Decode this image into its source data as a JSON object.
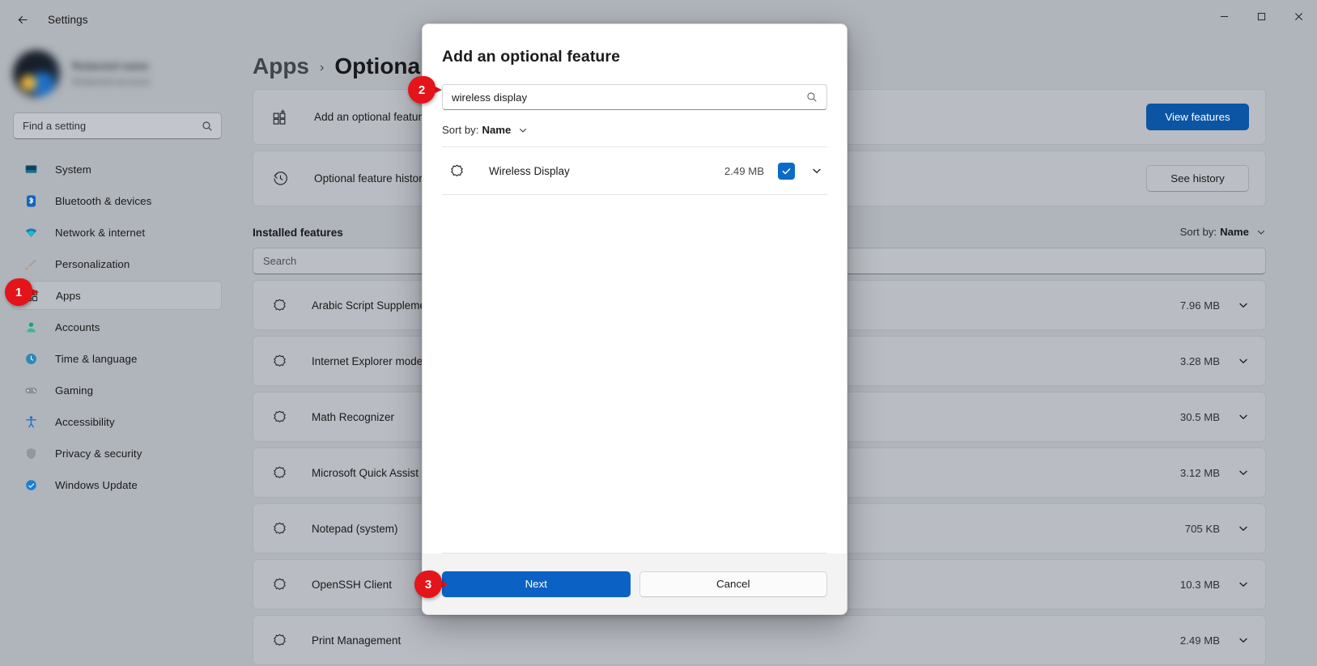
{
  "titlebar": {
    "title": "Settings",
    "back_icon": "back-arrow-icon",
    "minimize_label": "–",
    "maximize_label": "□",
    "close_label": "✕"
  },
  "sidebar": {
    "profile": {
      "name": "Redacted name",
      "subtitle": "Redacted account"
    },
    "search": {
      "placeholder": "Find a setting",
      "icon": "search-icon"
    },
    "items": [
      {
        "label": "System",
        "icon": "monitor-icon",
        "selected": false
      },
      {
        "label": "Bluetooth & devices",
        "icon": "bluetooth-icon",
        "selected": false
      },
      {
        "label": "Network & internet",
        "icon": "wifi-icon",
        "selected": false
      },
      {
        "label": "Personalization",
        "icon": "paintbrush-icon",
        "selected": false
      },
      {
        "label": "Apps",
        "icon": "apps-icon",
        "selected": true
      },
      {
        "label": "Accounts",
        "icon": "person-icon",
        "selected": false
      },
      {
        "label": "Time & language",
        "icon": "clock-globe-icon",
        "selected": false
      },
      {
        "label": "Gaming",
        "icon": "gamepad-icon",
        "selected": false
      },
      {
        "label": "Accessibility",
        "icon": "accessibility-icon",
        "selected": false
      },
      {
        "label": "Privacy & security",
        "icon": "shield-icon",
        "selected": false
      },
      {
        "label": "Windows Update",
        "icon": "update-icon",
        "selected": false
      }
    ]
  },
  "main": {
    "breadcrumb": {
      "parent": "Apps",
      "separator": "›",
      "current": "Optional"
    },
    "cards": [
      {
        "label": "Add an optional feature",
        "icon": "add-grid-icon",
        "action": "View features",
        "action_style": "primary"
      },
      {
        "label": "Optional feature history",
        "icon": "history-icon",
        "action": "See history",
        "action_style": "secondary"
      }
    ],
    "installed": {
      "title": "Installed features",
      "sort_label": "Sort by:",
      "sort_value": "Name",
      "search_placeholder": "Search",
      "rows": [
        {
          "name": "Arabic Script Supplemental Fonts",
          "size": "7.96 MB",
          "icon": "feature-gear-icon"
        },
        {
          "name": "Internet Explorer mode",
          "size": "3.28 MB",
          "icon": "feature-gear-icon"
        },
        {
          "name": "Math Recognizer",
          "size": "30.5 MB",
          "icon": "feature-gear-icon"
        },
        {
          "name": "Microsoft Quick Assist",
          "size": "3.12 MB",
          "icon": "feature-gear-icon"
        },
        {
          "name": "Notepad (system)",
          "size": "705 KB",
          "icon": "feature-gear-icon"
        },
        {
          "name": "OpenSSH Client",
          "size": "10.3 MB",
          "icon": "feature-gear-icon"
        },
        {
          "name": "Print Management",
          "size": "2.49 MB",
          "icon": "feature-gear-icon"
        }
      ]
    }
  },
  "dialog": {
    "title": "Add an optional feature",
    "search_value": "wireless display",
    "search_icon": "search-icon",
    "sort_label": "Sort by:",
    "sort_value": "Name",
    "results": [
      {
        "name": "Wireless Display",
        "size": "2.49 MB",
        "icon": "feature-gear-icon",
        "checked": true
      }
    ],
    "next_label": "Next",
    "cancel_label": "Cancel"
  },
  "callouts": [
    {
      "number": "1",
      "target": "sidebar-item-apps"
    },
    {
      "number": "2",
      "target": "dialog-search-input"
    },
    {
      "number": "3",
      "target": "dialog-next-button"
    }
  ],
  "colors": {
    "accent": "#0b62c4",
    "accent_dark": "#0b55a4",
    "checkbox": "#0a6cc6",
    "callout": "#e4141b",
    "window_bg": "#b0b4bb",
    "dialog_bg": "#ffffff",
    "footer_bg": "#f3f3f3"
  }
}
